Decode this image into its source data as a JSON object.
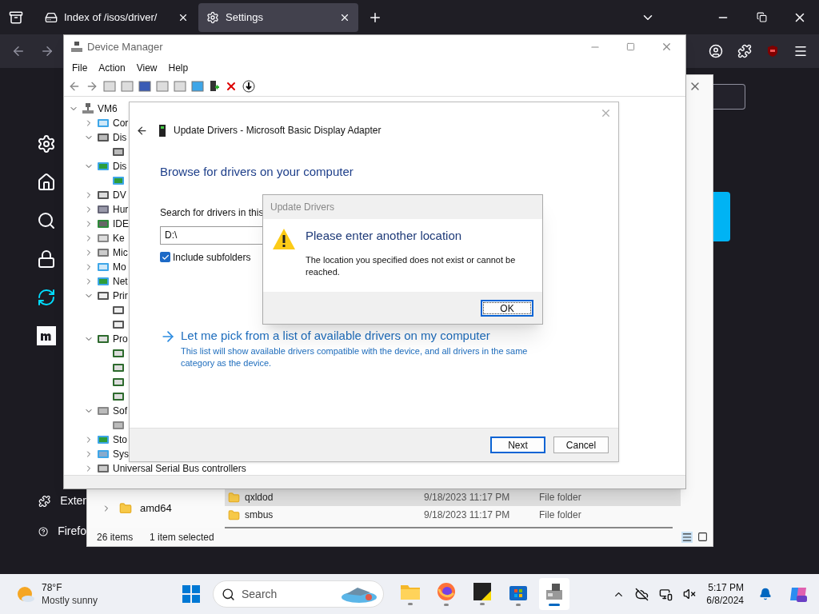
{
  "browser": {
    "tabs": [
      {
        "title": "Index of /isos/driver/",
        "selected": false
      },
      {
        "title": "Settings",
        "selected": true
      }
    ],
    "sidebar": [
      {
        "kind": "settings",
        "selected": false
      },
      {
        "kind": "home",
        "selected": false
      },
      {
        "kind": "search",
        "selected": false
      },
      {
        "kind": "privacy",
        "selected": false
      },
      {
        "kind": "sync",
        "selected": true
      },
      {
        "kind": "more",
        "selected": false
      }
    ],
    "footer_links": [
      {
        "kind": "extensions",
        "label": "Exter"
      },
      {
        "kind": "help",
        "label": "Firefo"
      }
    ]
  },
  "explorer": {
    "tree": [
      {
        "label": "amd64"
      }
    ],
    "rows": [
      {
        "name": "qxldod",
        "date": "9/18/2023 11:17 PM",
        "type": "File folder",
        "selected": true
      },
      {
        "name": "smbus",
        "date": "9/18/2023 11:17 PM",
        "type": "File folder",
        "selected": false
      }
    ],
    "status": {
      "items": "26 items",
      "selection": "1 item selected"
    }
  },
  "device_manager": {
    "title": "Device Manager",
    "menu": [
      "File",
      "Action",
      "View",
      "Help"
    ],
    "tree": {
      "label": "VM6",
      "expanded": true,
      "children": [
        {
          "label": "Cor",
          "kind": "computer",
          "expanded": false
        },
        {
          "label": "Dis",
          "kind": "disk",
          "expanded": true,
          "children": [
            {
              "kind": "disk"
            }
          ]
        },
        {
          "label": "Dis",
          "kind": "display",
          "expanded": true,
          "children": [
            {
              "kind": "display"
            }
          ]
        },
        {
          "label": "DV",
          "kind": "dvd",
          "expanded": false
        },
        {
          "label": "Hur",
          "kind": "hid",
          "expanded": false
        },
        {
          "label": "IDE",
          "kind": "ide",
          "expanded": false
        },
        {
          "label": "Ke",
          "kind": "keyboard",
          "expanded": false
        },
        {
          "label": "Mic",
          "kind": "mouse",
          "expanded": false
        },
        {
          "label": "Mo",
          "kind": "monitor",
          "expanded": false
        },
        {
          "label": "Net",
          "kind": "network",
          "expanded": false
        },
        {
          "label": "Prir",
          "kind": "printer",
          "expanded": true,
          "children": [
            {
              "kind": "printer"
            },
            {
              "kind": "printer"
            }
          ]
        },
        {
          "label": "Pro",
          "kind": "processor",
          "expanded": true,
          "children": [
            {
              "kind": "processor"
            },
            {
              "kind": "processor"
            },
            {
              "kind": "processor"
            },
            {
              "kind": "processor"
            }
          ]
        },
        {
          "label": "Sof",
          "kind": "software",
          "expanded": true,
          "children": [
            {
              "kind": "software"
            }
          ]
        },
        {
          "label": "Sto",
          "kind": "storage",
          "expanded": false
        },
        {
          "label": "Sys",
          "kind": "system",
          "expanded": false
        },
        {
          "label": "Universal Serial Bus controllers",
          "kind": "usb",
          "expanded": false
        }
      ]
    }
  },
  "wizard": {
    "title": "Update Drivers - Microsoft Basic Display Adapter",
    "heading": "Browse for drivers on your computer",
    "search_label": "Search for drivers in this",
    "path": "D:\\",
    "include_subfolders": {
      "label": "Include subfolders",
      "checked": true
    },
    "link": {
      "title": "Let me pick from a list of available drivers on my computer",
      "description": "This list will show available drivers compatible with the device, and all drivers in the same category as the device."
    },
    "buttons": [
      {
        "label": "Next",
        "default": true
      },
      {
        "label": "Cancel",
        "default": false
      }
    ]
  },
  "message_box": {
    "title": "Update Drivers",
    "heading": "Please enter another location",
    "message": "The location you specified does not exist or cannot be reached.",
    "button": "OK"
  },
  "taskbar": {
    "weather": {
      "temperature": "78°F",
      "condition": "Mostly sunny"
    },
    "search_placeholder": "Search",
    "apps": [
      {
        "kind": "explorer",
        "active": false
      },
      {
        "kind": "firefox",
        "active": false
      },
      {
        "kind": "notes",
        "active": false
      },
      {
        "kind": "store",
        "active": false
      },
      {
        "kind": "devmgr",
        "active": true
      }
    ],
    "time": "5:17 PM",
    "date": "6/8/2024"
  }
}
